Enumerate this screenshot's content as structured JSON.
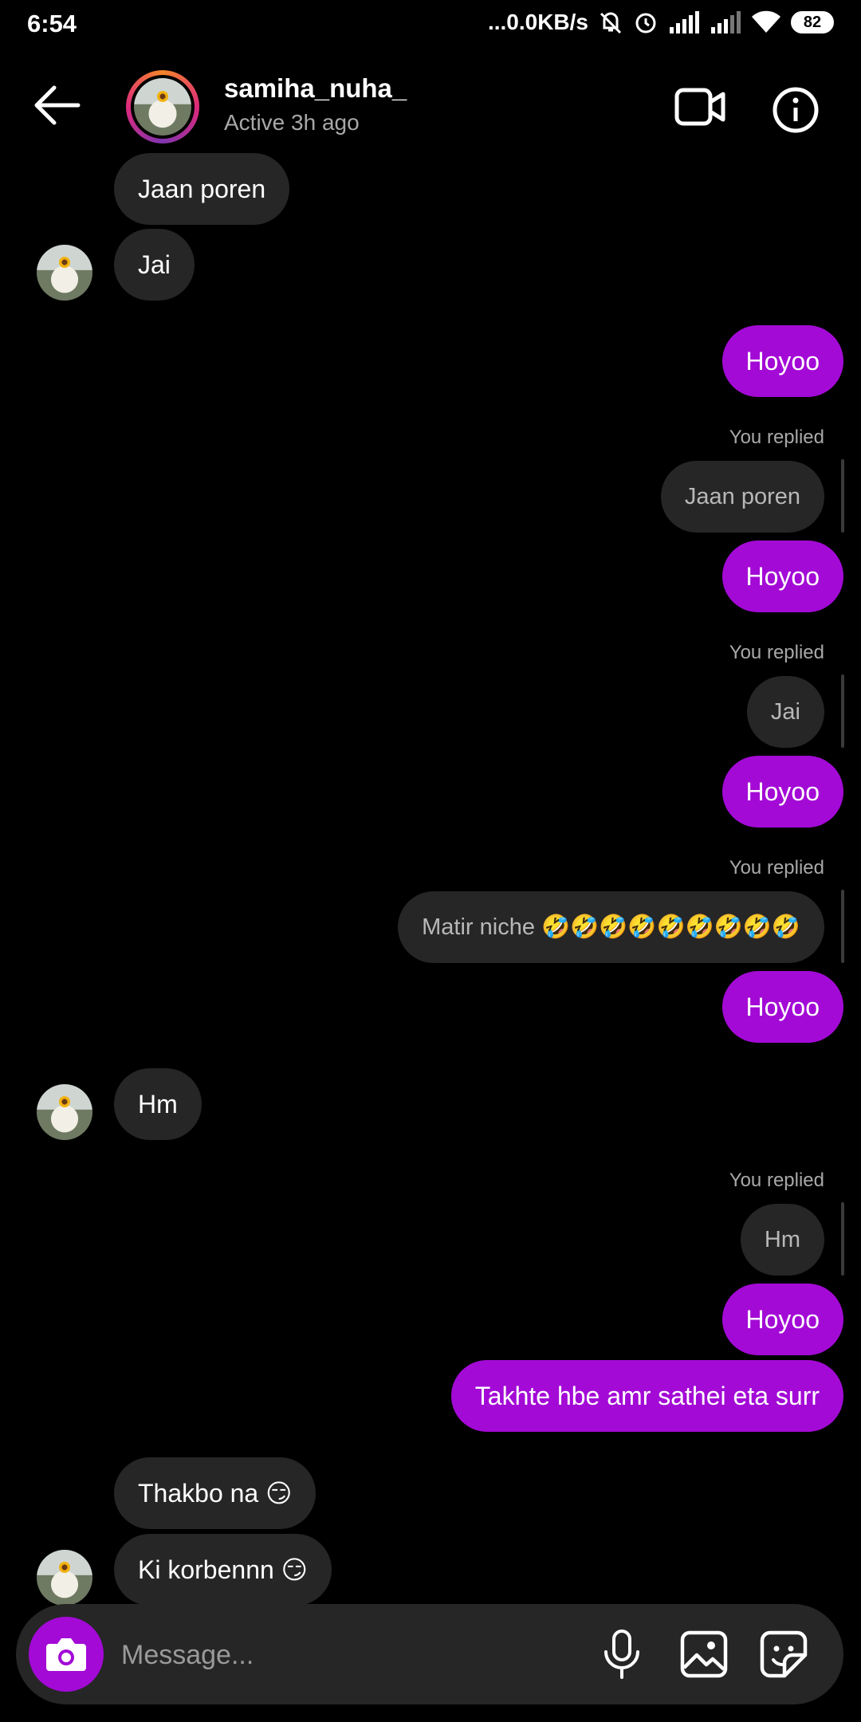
{
  "status_bar": {
    "time": "6:54",
    "net_speed": "...0.0KB/s",
    "battery": "82"
  },
  "header": {
    "name": "samiha_nuha_",
    "status": "Active 3h ago"
  },
  "messages": [
    {
      "text": "Jaan poren"
    },
    {
      "text": "Jai"
    },
    {
      "text": "Hoyoo"
    },
    {
      "replied_label": "You replied",
      "quoted": "Jaan poren"
    },
    {
      "text": "Hoyoo"
    },
    {
      "replied_label": "You replied",
      "quoted": "Jai"
    },
    {
      "text": "Hoyoo"
    },
    {
      "replied_label": "You replied",
      "quoted": "Matir niche 🤣🤣🤣🤣🤣🤣🤣🤣🤣"
    },
    {
      "text": "Hoyoo"
    },
    {
      "text": "Hm"
    },
    {
      "replied_label": "You replied",
      "quoted": "Hm"
    },
    {
      "text": "Hoyoo"
    },
    {
      "text": "Takhte hbe amr sathei eta surr"
    },
    {
      "text": "Thakbo na 😏"
    },
    {
      "text": "Ki korbennn 😏"
    }
  ],
  "composer": {
    "placeholder": "Message..."
  },
  "colors": {
    "background": "#000000",
    "incoming_bubble": "#262626",
    "outgoing_bubble": "#a30ad6"
  }
}
